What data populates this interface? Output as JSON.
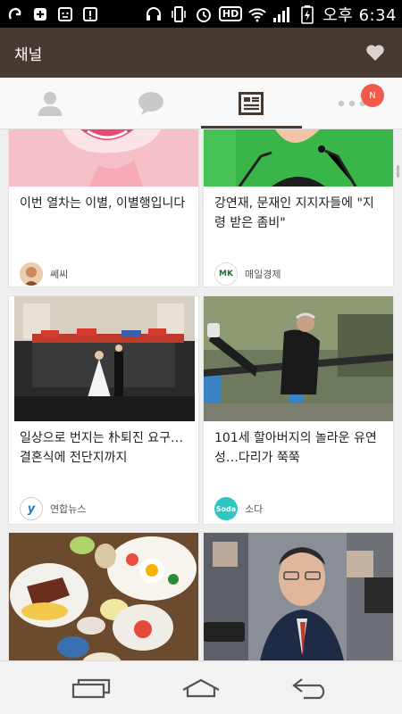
{
  "status_bar": {
    "time": "오후 6:34",
    "hd": "HD"
  },
  "header": {
    "title": "채널"
  },
  "tabs": [
    {
      "icon": "person-icon"
    },
    {
      "icon": "chat-icon"
    },
    {
      "icon": "news-list-icon"
    },
    {
      "icon": "more-icon",
      "badge": "N"
    }
  ],
  "cards": [
    {
      "title": "이번 열차는 이별, 이별행입니다",
      "source": "쎄씨",
      "logo_text": ""
    },
    {
      "title": "강연재, 문재인 지지자들에 \"지령 받은 좀비\"",
      "source": "매일경제",
      "logo_text": "MK"
    },
    {
      "title": "일상으로 번지는 朴퇴진 요구…결혼식에 전단지까지",
      "source": "연합뉴스",
      "logo_text": "y"
    },
    {
      "title": "101세 할아버지의 놀라운 유연성…다리가 쭉쭉",
      "source": "소다",
      "logo_text": "Soda"
    }
  ],
  "colors": {
    "header": "#473a31",
    "badge": "#f15a4a"
  }
}
